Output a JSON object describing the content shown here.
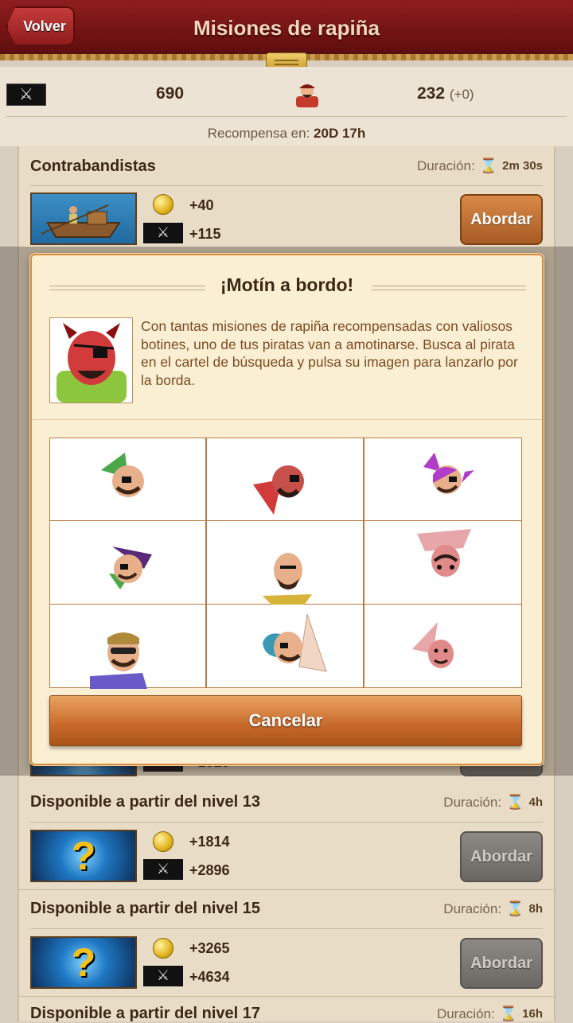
{
  "header": {
    "back_label": "Volver",
    "title": "Misiones de rapiña"
  },
  "stats": {
    "raid_points": "690",
    "pirates": "232",
    "pirates_delta": "(+0)",
    "reward_prefix": "Recompensa en:",
    "reward_time": "20D 17h"
  },
  "duration_label": "Duración:",
  "missions": [
    {
      "title": "Contrabandistas",
      "duration": "2m 30s",
      "gold": "+40",
      "raid": "+115",
      "button": "Abordar",
      "enabled": true
    },
    {
      "title": "",
      "duration": "",
      "gold": "",
      "raid": "+1810",
      "button": "",
      "enabled": false
    },
    {
      "title": "Disponible a partir del nivel 13",
      "duration": "4h",
      "gold": "+1814",
      "raid": "+2896",
      "button": "Abordar",
      "enabled": false
    },
    {
      "title": "Disponible a partir del nivel 15",
      "duration": "8h",
      "gold": "+3265",
      "raid": "+4634",
      "button": "Abordar",
      "enabled": false
    },
    {
      "title": "Disponible a partir del nivel 17",
      "duration": "16h"
    }
  ],
  "dialog": {
    "title": "¡Motín a bordo!",
    "text": "Con tantas misiones de rapiña recompensadas con valiosos botines, uno de tus piratas van a amotinarse. Busca al pirata en el cartel de búsqueda y pulsa su imagen para lanzarlo por la borda.",
    "cancel_label": "Cancelar"
  },
  "colors": {
    "accent": "#c7692a",
    "header": "#7a1616",
    "gold": "#e2b31c"
  },
  "icons": [
    "swords-icon",
    "pirate-icon",
    "hourglass-icon",
    "coin-icon",
    "question-mark-icon"
  ]
}
